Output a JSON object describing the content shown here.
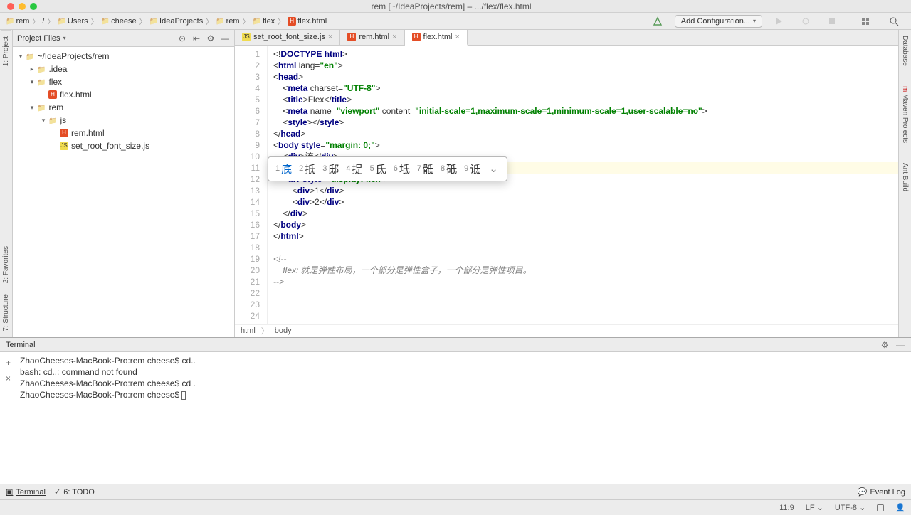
{
  "titlebar": {
    "title": "rem [~/IdeaProjects/rem] – .../flex/flex.html"
  },
  "breadcrumbs": {
    "items": [
      "rem",
      "/",
      "Users",
      "cheese",
      "IdeaProjects",
      "rem",
      "flex",
      "flex.html"
    ]
  },
  "toolbar": {
    "add_configuration": "Add Configuration..."
  },
  "project_panel": {
    "title": "Project Files"
  },
  "tree": {
    "root": {
      "label": "~/IdeaProjects/rem"
    },
    "idea": {
      "label": ".idea"
    },
    "flex": {
      "label": "flex"
    },
    "flex_html": {
      "label": "flex.html"
    },
    "rem": {
      "label": "rem"
    },
    "js": {
      "label": "js"
    },
    "rem_html": {
      "label": "rem.html"
    },
    "set_root": {
      "label": "set_root_font_size.js"
    }
  },
  "tabs": [
    {
      "label": "set_root_font_size.js",
      "type": "js"
    },
    {
      "label": "rem.html",
      "type": "html"
    },
    {
      "label": "flex.html",
      "type": "html",
      "active": true
    }
  ],
  "code": {
    "lines": [
      "<!DOCTYPE html>",
      "<html lang=\"en\">",
      "<head>",
      "    <meta charset=\"UTF-8\">",
      "    <title>Flex</title>",
      "    <meta name=\"viewport\" content=\"initial-scale=1,maximum-scale=1,minimum-scale=1,user-scalable=no\">",
      "    <style></style>",
      "</head>",
      "<body style=\"margin: 0;\">",
      "    <div>流</div>",
      "    di v",
      "    <div style=\"display: flex\">",
      "        <div>1</div>",
      "        <div>2</div>",
      "    </div>",
      "</body>",
      "</html>",
      "",
      "<!--",
      "    flex: 就是弹性布局，一个部分是弹性盒子，一个部分是弹性项目。",
      "",
      "",
      "",
      "-->"
    ],
    "current_line": 11
  },
  "ime": {
    "candidates": [
      {
        "n": "1",
        "c": "底"
      },
      {
        "n": "2",
        "c": "抵"
      },
      {
        "n": "3",
        "c": "邸"
      },
      {
        "n": "4",
        "c": "提"
      },
      {
        "n": "5",
        "c": "氐"
      },
      {
        "n": "6",
        "c": "坻"
      },
      {
        "n": "7",
        "c": "骶"
      },
      {
        "n": "8",
        "c": "砥"
      },
      {
        "n": "9",
        "c": "诋"
      }
    ]
  },
  "editor_breadcrumb": {
    "items": [
      "html",
      "body"
    ]
  },
  "terminal": {
    "title": "Terminal",
    "lines": [
      "ZhaoCheeses-MacBook-Pro:rem cheese$ cd..",
      "bash: cd..: command not found",
      "ZhaoCheeses-MacBook-Pro:rem cheese$ cd .",
      "ZhaoCheeses-MacBook-Pro:rem cheese$ "
    ]
  },
  "bottom_tabs": {
    "terminal": "Terminal",
    "todo": "6: TODO",
    "event_log": "Event Log"
  },
  "status": {
    "position": "11:9",
    "line_sep": "LF",
    "encoding": "UTF-8"
  },
  "right_tabs": {
    "database": "Database",
    "maven": "Maven Projects",
    "ant": "Ant Build"
  },
  "left_tabs": {
    "project": "1: Project",
    "structure": "7: Structure",
    "favorites": "2: Favorites"
  }
}
